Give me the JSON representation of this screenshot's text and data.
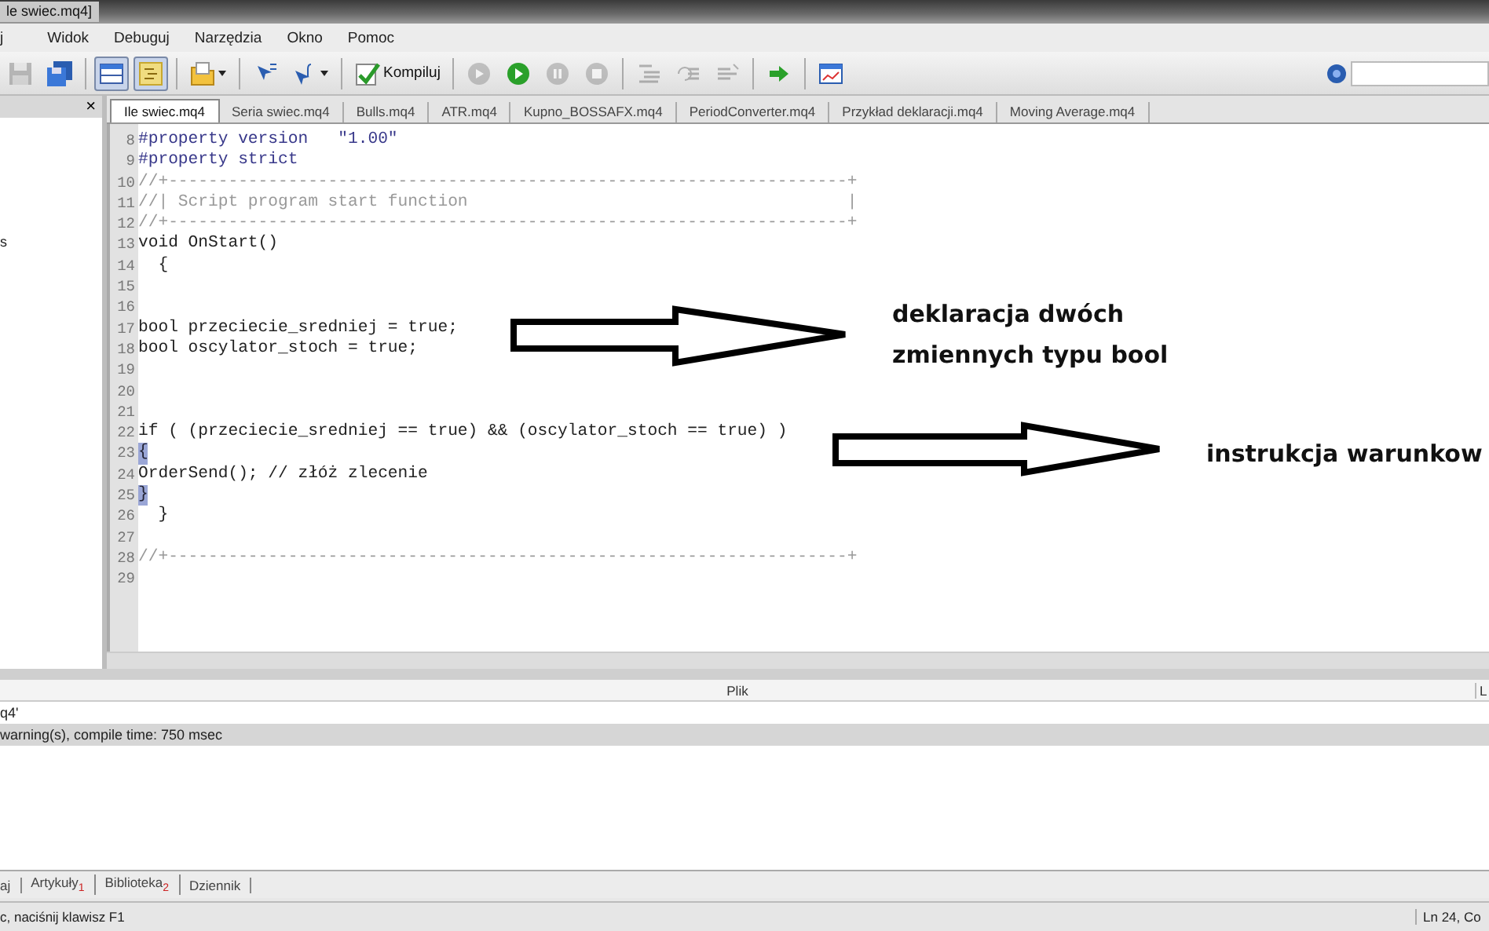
{
  "window": {
    "title": "le swiec.mq4]"
  },
  "menu": [
    "j",
    "Widok",
    "Debuguj",
    "Narzędzia",
    "Okno",
    "Pomoc"
  ],
  "toolbar": {
    "buttons": [
      {
        "kind": "save",
        "pressed": false,
        "disabled": true
      },
      {
        "kind": "save-all",
        "pressed": false,
        "disabled": false
      },
      {
        "kind": "separator"
      },
      {
        "kind": "panel",
        "pressed": true,
        "disabled": false
      },
      {
        "kind": "navigator",
        "pressed": true,
        "disabled": false
      },
      {
        "kind": "separator"
      },
      {
        "kind": "open",
        "pressed": false,
        "disabled": false,
        "dropdown": true
      },
      {
        "kind": "separator"
      },
      {
        "kind": "step-in",
        "pressed": false,
        "disabled": false
      },
      {
        "kind": "function",
        "pressed": false,
        "disabled": false,
        "dropdown": true
      },
      {
        "kind": "separator"
      },
      {
        "kind": "compile",
        "label": "Kompiluj",
        "pressed": false,
        "disabled": false
      },
      {
        "kind": "separator"
      },
      {
        "kind": "start",
        "pressed": false,
        "disabled": true
      },
      {
        "kind": "play",
        "pressed": false,
        "disabled": false
      },
      {
        "kind": "pause",
        "pressed": false,
        "disabled": true
      },
      {
        "kind": "stop",
        "pressed": false,
        "disabled": true
      },
      {
        "kind": "separator"
      },
      {
        "kind": "indent",
        "pressed": false,
        "disabled": true
      },
      {
        "kind": "comment",
        "pressed": false,
        "disabled": true
      },
      {
        "kind": "uncomment",
        "pressed": false,
        "disabled": true
      },
      {
        "kind": "separator"
      },
      {
        "kind": "go",
        "pressed": false,
        "disabled": false
      },
      {
        "kind": "separator"
      },
      {
        "kind": "chart",
        "pressed": false,
        "disabled": false
      }
    ]
  },
  "left_panel": {
    "close": "×",
    "item": "s"
  },
  "tabs": [
    {
      "label": "Ile swiec.mq4",
      "selected": true
    },
    {
      "label": "Seria swiec.mq4",
      "selected": false
    },
    {
      "label": "Bulls.mq4",
      "selected": false
    },
    {
      "label": "ATR.mq4",
      "selected": false
    },
    {
      "label": "Kupno_BOSSAFX.mq4",
      "selected": false
    },
    {
      "label": "PeriodConverter.mq4",
      "selected": false
    },
    {
      "label": "Przykład deklaracji.mq4",
      "selected": false
    },
    {
      "label": "Moving Average.mq4",
      "selected": false
    }
  ],
  "code": [
    {
      "number": "8",
      "kind": "preprocessor",
      "text": "#property version   \"1.00\""
    },
    {
      "number": "9",
      "kind": "preprocessor",
      "text": "#property strict"
    },
    {
      "number": "10",
      "kind": "comment",
      "text": "//+--------------------------------------------------------------------+"
    },
    {
      "number": "11",
      "kind": "comment",
      "text": "//| Script program start function                                      |"
    },
    {
      "number": "12",
      "kind": "comment",
      "text": "//+--------------------------------------------------------------------+"
    },
    {
      "number": "13",
      "kind": "code",
      "text": "void OnStart()"
    },
    {
      "number": "14",
      "kind": "code",
      "text": "  {"
    },
    {
      "number": "15"
    },
    {
      "number": "16"
    },
    {
      "number": "17",
      "kind": "code",
      "text": "bool przeciecie_sredniej = true;"
    },
    {
      "number": "18",
      "kind": "code",
      "text": "bool oscylator_stoch = true;"
    },
    {
      "number": "19"
    },
    {
      "number": "20"
    },
    {
      "number": "21"
    },
    {
      "number": "22",
      "kind": "code",
      "text": "if ( (przeciecie_sredniej == true) && (oscylator_stoch == true) )"
    },
    {
      "number": "23",
      "kind": "brace",
      "text": "{",
      "highlighted": true
    },
    {
      "number": "24",
      "kind": "code",
      "text": "OrderSend(); // złóż zlecenie"
    },
    {
      "number": "25",
      "kind": "brace",
      "text": "}",
      "highlighted": true
    },
    {
      "number": "26",
      "kind": "code",
      "text": "  }"
    },
    {
      "number": "27"
    },
    {
      "number": "28",
      "kind": "comment",
      "text": "//+--------------------------------------------------------------------+"
    },
    {
      "number": "29"
    }
  ],
  "annotations": [
    {
      "text": "deklaracja dwóch\nzmiennych typu bool"
    },
    {
      "text": "instrukcja warunkow"
    }
  ],
  "output": {
    "columns": [
      "Plik",
      "L"
    ],
    "rows": [
      {
        "text": "q4'",
        "selected": false
      },
      {
        "text": "warning(s), compile time: 750 msec",
        "selected": true
      }
    ]
  },
  "bottom_tabs": [
    {
      "label": "aj"
    },
    {
      "label": "Artykuły$_{1}$"
    },
    {
      "label": "Biblioteka$_{2}$"
    },
    {
      "label": "Dziennik"
    }
  ],
  "status_bar": {
    "left": "c, naciśnij klawisz F1",
    "right": "Ln 24, Co"
  }
}
